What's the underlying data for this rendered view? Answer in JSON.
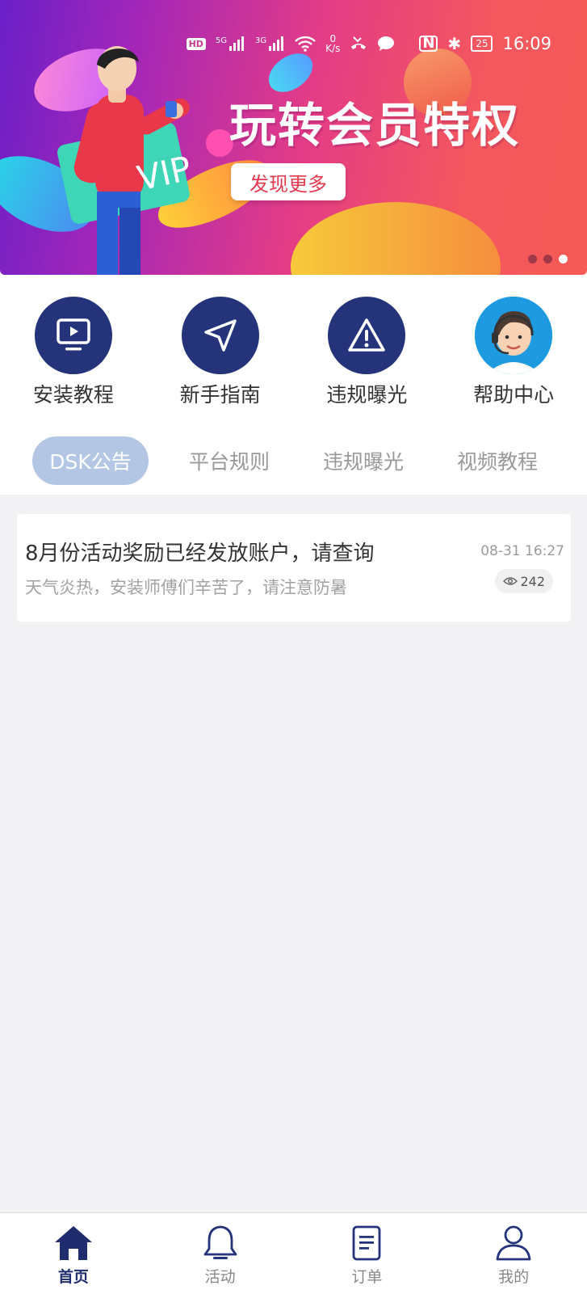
{
  "status_bar": {
    "hd": "HD",
    "net1": "5G",
    "net2": "3G",
    "speed_value": "0",
    "speed_unit": "K/s",
    "battery": "25",
    "time": "16:09"
  },
  "banner": {
    "title": "玩转会员特权",
    "button_label": "发现更多",
    "badge_text": "VIP",
    "pages": 3,
    "active_page": 3
  },
  "quick_menu": [
    {
      "label": "安装教程",
      "icon": "tv-play-icon"
    },
    {
      "label": "新手指南",
      "icon": "navigation-arrow-icon"
    },
    {
      "label": "违规曝光",
      "icon": "warning-triangle-icon"
    },
    {
      "label": "帮助中心",
      "icon": "customer-service-avatar-icon"
    }
  ],
  "tabs": [
    {
      "label": "DSK公告",
      "active": true
    },
    {
      "label": "平台规则",
      "active": false
    },
    {
      "label": "违规曝光",
      "active": false
    },
    {
      "label": "视频教程",
      "active": false
    }
  ],
  "announcements": [
    {
      "title": "8月份活动奖励已经发放账户，请查询",
      "subtitle": "天气炎热，安装师傅们辛苦了，请注意防暑",
      "time": "08-31 16:27",
      "views": "242"
    }
  ],
  "bottom_nav": [
    {
      "label": "首页",
      "icon": "home-icon",
      "active": true
    },
    {
      "label": "活动",
      "icon": "bell-icon",
      "active": false
    },
    {
      "label": "订单",
      "icon": "document-icon",
      "active": false
    },
    {
      "label": "我的",
      "icon": "user-icon",
      "active": false
    }
  ],
  "colors": {
    "brand_navy": "#24337a",
    "tab_active_bg": "#b3c6e3",
    "banner_button_text": "#e23a4f"
  }
}
